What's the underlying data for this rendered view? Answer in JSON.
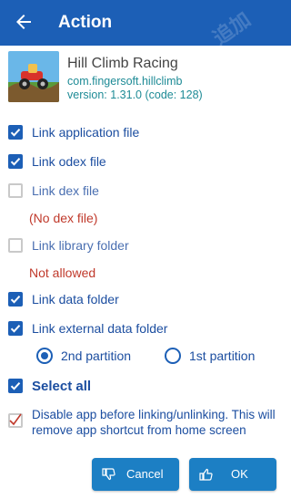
{
  "toolbar": {
    "title": "Action",
    "watermark": "追加"
  },
  "app": {
    "name": "Hill Climb Racing",
    "package": "com.fingersoft.hillclimb",
    "version": "version: 1.31.0 (code: 128)",
    "icon": "hill-climb-racing-app-icon"
  },
  "options": {
    "link_application_file": {
      "label": "Link application file",
      "checked": true
    },
    "link_odex_file": {
      "label": "Link odex file",
      "checked": true
    },
    "link_dex_file": {
      "label": "Link dex file",
      "checked": false,
      "note": "(No dex file)"
    },
    "link_library_folder": {
      "label": "Link library folder",
      "checked": false,
      "note": "Not allowed"
    },
    "link_data_folder": {
      "label": "Link data folder",
      "checked": true
    },
    "link_external_data_folder": {
      "label": "Link external data folder",
      "checked": true
    }
  },
  "partition": {
    "options": [
      {
        "label": "2nd partition",
        "selected": true
      },
      {
        "label": "1st partition",
        "selected": false
      }
    ]
  },
  "select_all": {
    "label": "Select all",
    "checked": true
  },
  "disable_app": {
    "label": "Disable app before linking/unlinking. This will remove app shortcut from home screen",
    "checked": false
  },
  "buttons": {
    "cancel": "Cancel",
    "ok": "OK"
  },
  "colors": {
    "primary": "#1c5fb6",
    "button": "#1c7fc4",
    "note": "#c0392b",
    "link": "#1e8b96"
  }
}
